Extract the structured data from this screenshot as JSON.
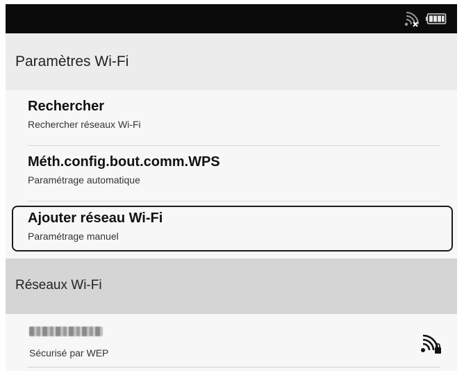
{
  "header": {
    "title": "Paramètres Wi-Fi"
  },
  "menu": {
    "items": [
      {
        "title": "Rechercher",
        "subtitle": "Rechercher réseaux Wi-Fi",
        "selected": false
      },
      {
        "title": "Méth.config.bout.comm.WPS",
        "subtitle": "Paramétrage automatique",
        "selected": false
      },
      {
        "title": "Ajouter réseau Wi-Fi",
        "subtitle": "Paramétrage manuel",
        "selected": true
      }
    ]
  },
  "networks_section": {
    "heading": "Réseaux Wi-Fi",
    "items": [
      {
        "name_obscured": true,
        "security": "Sécurisé par WEP",
        "icon": "wifi-lock-icon"
      }
    ]
  },
  "statusbar": {
    "icons": [
      "wifi-disconnected-icon",
      "battery-icon"
    ]
  }
}
